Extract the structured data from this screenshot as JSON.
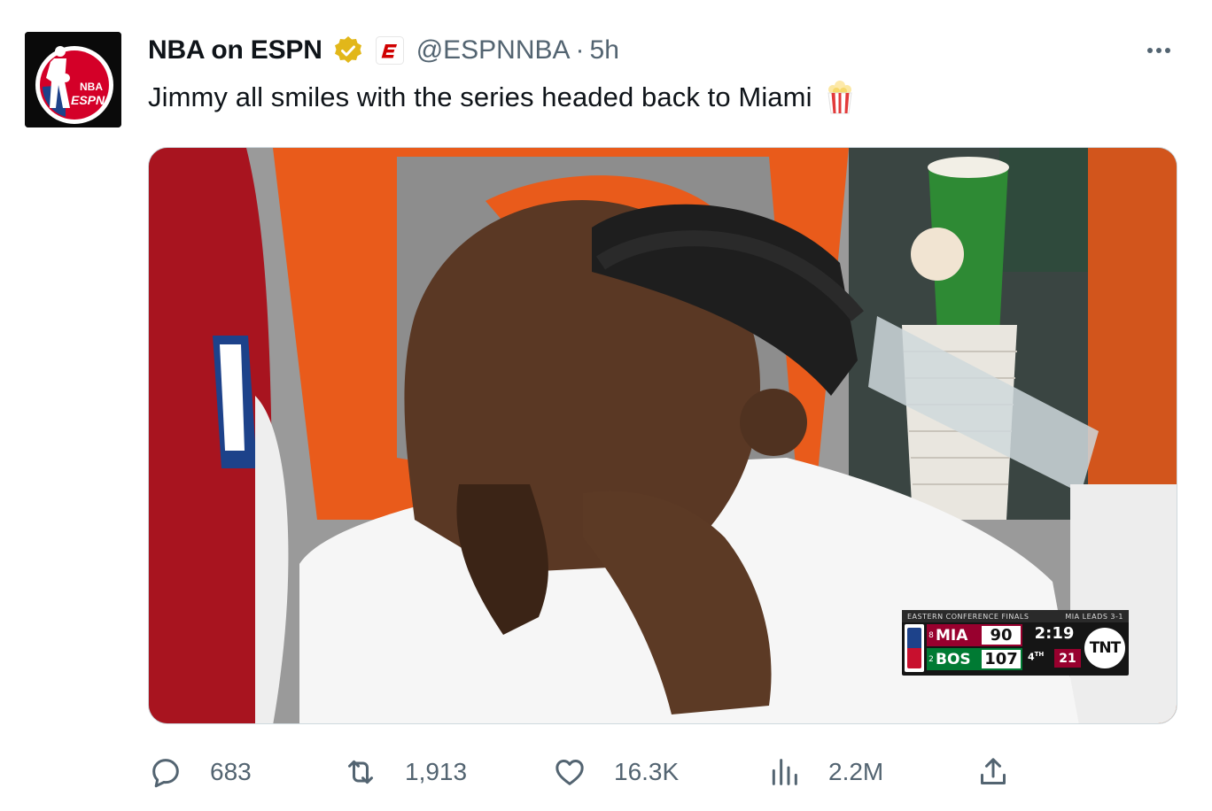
{
  "account": {
    "name": "NBA on ESPN",
    "handle": "@ESPNNBA",
    "separator": "·",
    "time": "5h",
    "avatar_text": "NBA ESPN"
  },
  "tweet": {
    "text": "Jimmy all smiles with the series headed back to Miami",
    "emoji": "popcorn-emoji"
  },
  "media": {
    "scorebug": {
      "header_left": "EASTERN CONFERENCE FINALS",
      "header_right": "MIA LEADS 3-1",
      "teams": [
        {
          "seed": "8",
          "abbr": "MIA",
          "score": "90"
        },
        {
          "seed": "2",
          "abbr": "BOS",
          "score": "107"
        }
      ],
      "clock": "2:19",
      "period": "4",
      "period_suffix": "TH",
      "shot_clock": "21",
      "network": "TNT"
    }
  },
  "actions": {
    "replies": "683",
    "retweets": "1,913",
    "likes": "16.3K",
    "views": "2.2M"
  },
  "icons": {
    "more": "more-horizontal-icon",
    "verified": "verified-badge-icon",
    "affiliate": "espn-affiliate-icon",
    "reply": "reply-icon",
    "retweet": "retweet-icon",
    "like": "heart-icon",
    "views": "views-chart-icon",
    "share": "share-icon"
  },
  "colors": {
    "text": "#0f1419",
    "secondary": "#536471",
    "verified_gold": "#e2b719",
    "espn_red": "#d00000",
    "heat_red": "#98002e",
    "celtics_green": "#007a33"
  }
}
